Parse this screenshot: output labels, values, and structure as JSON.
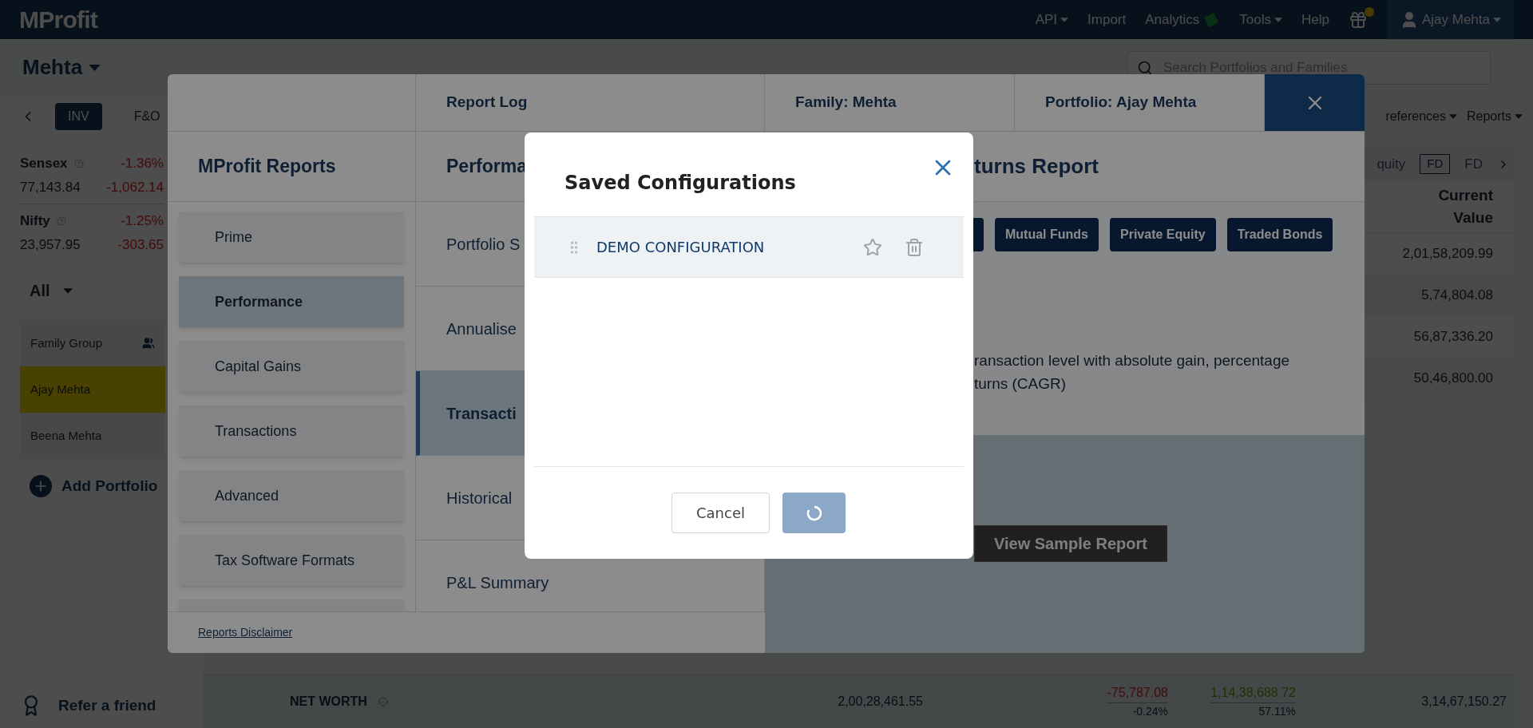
{
  "top_bar": {
    "logo": "MProfit",
    "menu": [
      {
        "label": "API",
        "kind": "dropdown"
      },
      {
        "label": "Import",
        "kind": "link"
      },
      {
        "label": "Analytics",
        "kind": "new"
      },
      {
        "label": "Tools",
        "kind": "dropdown"
      },
      {
        "label": "Help",
        "kind": "link"
      }
    ],
    "user": "Ajay Mehta"
  },
  "header": {
    "family": "Mehta",
    "search": {
      "placeholder": "Search Portfolios and Families"
    }
  },
  "sidebar": {
    "tabs": [
      {
        "label": "INV",
        "selected": true
      },
      {
        "label": "F&O",
        "selected": false
      }
    ],
    "indices": [
      {
        "name": "Sensex",
        "change_pct": "-1.36%",
        "value": "77,143.84",
        "change": "-1,062.14"
      },
      {
        "name": "Nifty",
        "change_pct": "-1.25%",
        "value": "23,957.95",
        "change": "-303.65"
      }
    ],
    "filter": "All",
    "portfolios": [
      {
        "name": "Family Group",
        "kind": "group",
        "selected": false
      },
      {
        "name": "Ajay Mehta",
        "kind": "person",
        "selected": true
      },
      {
        "name": "Beena Mehta",
        "kind": "person",
        "selected": false
      }
    ],
    "add_portfolio": "Add Portfolio",
    "refer": "Refer a friend"
  },
  "toolbar": [
    "references",
    "Reports"
  ],
  "holdings": {
    "tabs": [
      {
        "label": "quity",
        "selected": false
      },
      {
        "label": "FD",
        "selected": true
      },
      {
        "label": "FD",
        "selected": false
      }
    ],
    "column": "Current Value",
    "rows": [
      "2,01,58,209.99",
      "5,74,804.08",
      "56,87,336.20",
      "50,46,800.00"
    ]
  },
  "net_worth": {
    "label": "NET WORTH",
    "invested": "2,00,28,461.55",
    "today_gain": "-75,787.08",
    "today_pct": "-0.24%",
    "total_gain": "1,14,38,688.72",
    "total_pct": "57.11%",
    "current": "3,14,67,150.27"
  },
  "reports_modal": {
    "tabs": [
      "Report Log",
      "Family: Mehta",
      "Portfolio: Ajay Mehta"
    ],
    "title": "MProfit Reports",
    "categories": [
      {
        "label": "Prime",
        "selected": false
      },
      {
        "label": "Performance",
        "selected": true
      },
      {
        "label": "Capital Gains",
        "selected": false
      },
      {
        "label": "Transactions",
        "selected": false
      },
      {
        "label": "Advanced",
        "selected": false
      },
      {
        "label": "Tax Software Formats",
        "selected": false
      }
    ],
    "footer_link": "Reports Disclaimer",
    "list_title": "Performa",
    "reports": [
      {
        "label": "Portfolio S",
        "selected": false
      },
      {
        "label": "Annualise",
        "selected": false
      },
      {
        "label": "Transacti",
        "selected": true
      },
      {
        "label": "Historical",
        "selected": false
      },
      {
        "label": "P&L Summary",
        "selected": false
      }
    ],
    "detail": {
      "title": "turns Report",
      "asset_types": [
        "Mutual Funds",
        "Private Equity",
        "Traded Bonds"
      ],
      "description": [
        "ransaction level with absolute gain, percentage",
        "turns (CAGR)"
      ],
      "sample_button": "View Sample Report"
    }
  },
  "dialog": {
    "title": "Saved Configurations",
    "configs": [
      {
        "name": "DEMO CONFIGURATION",
        "starred": false
      }
    ],
    "cancel": "Cancel",
    "confirm_loading": true
  }
}
